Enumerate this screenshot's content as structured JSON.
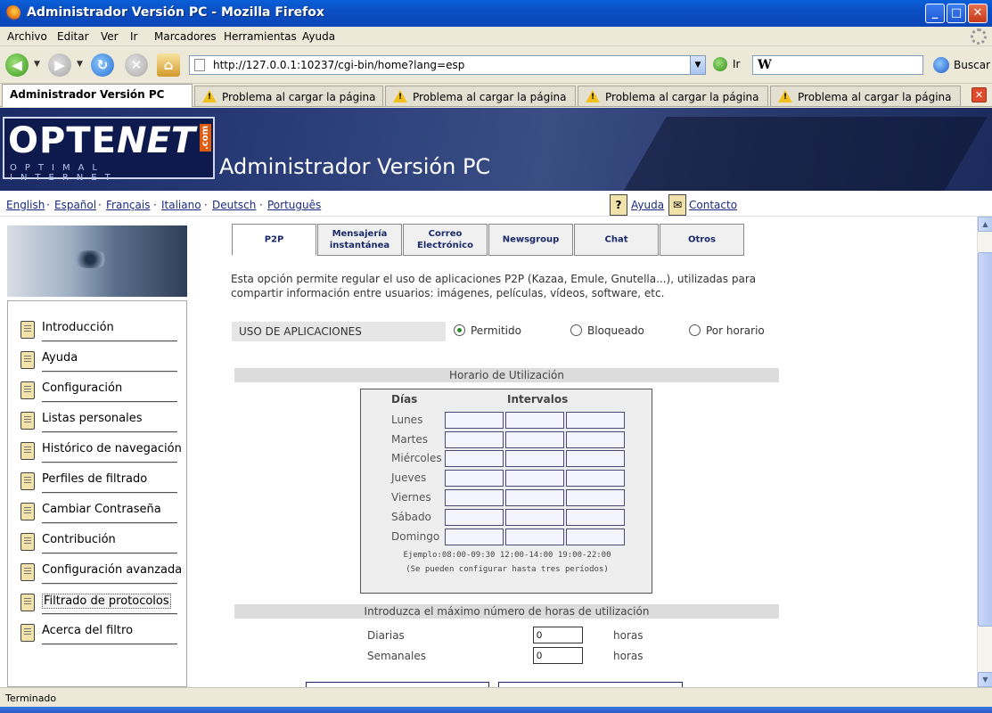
{
  "window": {
    "title": "Administrador Versión PC - Mozilla Firefox",
    "controls": {
      "minimize": "_",
      "maximize": "□",
      "close": "✕"
    }
  },
  "menu": [
    "Archivo",
    "Editar",
    "Ver",
    "Ir",
    "Marcadores",
    "Herramientas",
    "Ayuda"
  ],
  "navbar": {
    "url": "http://127.0.0.1:10237/cgi-bin/home?lang=esp",
    "go_label": "Ir",
    "search_engine": "W",
    "search_label": "Buscar"
  },
  "tabs": [
    {
      "label": "Administrador Versión PC",
      "active": true
    },
    {
      "label": "Problema al cargar la página",
      "icon": "warning-icon"
    },
    {
      "label": "Problema al cargar la página",
      "icon": "warning-icon"
    },
    {
      "label": "Problema al cargar la página",
      "icon": "warning-icon"
    },
    {
      "label": "Problema al cargar la página",
      "icon": "warning-icon"
    }
  ],
  "banner": {
    "logo_left": "OPTE",
    "logo_right": "NET",
    "logo_com": ".com",
    "logo_tagline": "OPTIMAL INTERNET",
    "title": "Administrador Versión PC"
  },
  "languages": [
    "English",
    "Español",
    "Français",
    "Italiano",
    "Deutsch",
    "Português"
  ],
  "language_separator": "·",
  "help_links": {
    "help_icon": "?",
    "help": "Ayuda",
    "contact": "Contacto"
  },
  "sidebar": {
    "items": [
      {
        "label": "Introducción"
      },
      {
        "label": "Ayuda"
      },
      {
        "label": "Configuración"
      },
      {
        "label": "Listas personales"
      },
      {
        "label": "Histórico de navegación"
      },
      {
        "label": "Perfiles de filtrado"
      },
      {
        "label": "Cambiar Contraseña"
      },
      {
        "label": "Contribución"
      },
      {
        "label": "Configuración avanzada"
      },
      {
        "label": "Filtrado de protocolos",
        "selected": true
      },
      {
        "label": "Acerca del filtro"
      }
    ]
  },
  "content_tabs": [
    {
      "label": "P2P",
      "active": true
    },
    {
      "label": "Mensajería instantánea"
    },
    {
      "label": "Correo Electrónico"
    },
    {
      "label": "Newsgroup"
    },
    {
      "label": "Chat"
    },
    {
      "label": "Otros"
    }
  ],
  "description": "Esta opción permite regular el uso de aplicaciones P2P (Kazaa, Emule, Gnutella...), utilizadas para compartir información entre usuarios: imágenes, películas, vídeos, software, etc.",
  "usage": {
    "label": "USO DE APLICACIONES",
    "options": [
      {
        "label": "Permitido",
        "checked": true
      },
      {
        "label": "Bloqueado",
        "checked": false
      },
      {
        "label": "Por horario",
        "checked": false
      }
    ]
  },
  "schedule": {
    "section_title": "Horario de Utilización",
    "days_header": "Días",
    "intervals_header": "Intervalos",
    "days": [
      "Lunes",
      "Martes",
      "Miércoles",
      "Jueves",
      "Viernes",
      "Sábado",
      "Domingo"
    ],
    "example": "Ejemplo:08:00-09:30 12:00-14:00 19:00-22:00",
    "note": "(Se pueden configurar hasta tres períodos)"
  },
  "max_hours": {
    "section_title": "Introduzca el máximo número de horas de utilización",
    "rows": [
      {
        "label": "Diarias",
        "value": "0",
        "unit": "horas"
      },
      {
        "label": "Semanales",
        "value": "0",
        "unit": "horas"
      }
    ]
  },
  "status": "Terminado"
}
